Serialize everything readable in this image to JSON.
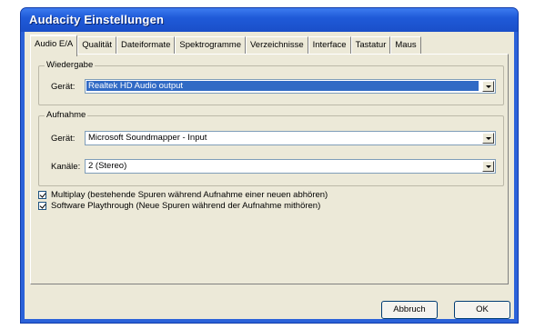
{
  "window": {
    "title": "Audacity Einstellungen"
  },
  "tabs": [
    {
      "label": "Audio E/A",
      "active": true
    },
    {
      "label": "Qualität"
    },
    {
      "label": "Dateiformate"
    },
    {
      "label": "Spektrogramme"
    },
    {
      "label": "Verzeichnisse"
    },
    {
      "label": "Interface"
    },
    {
      "label": "Tastatur"
    },
    {
      "label": "Maus"
    }
  ],
  "playback": {
    "group_label": "Wiedergabe",
    "device_label": "Gerät:",
    "device_value": "Realtek HD Audio output"
  },
  "recording": {
    "group_label": "Aufnahme",
    "device_label": "Gerät:",
    "device_value": "Microsoft Soundmapper - Input",
    "channels_label": "Kanäle:",
    "channels_value": "2 (Stereo)"
  },
  "options": [
    {
      "label": "Multiplay (bestehende Spuren während Aufnahme einer neuen abhören)",
      "checked": true
    },
    {
      "label": "Software Playthrough (Neue Spuren während der Aufnahme mithören)",
      "checked": true
    }
  ],
  "buttons": {
    "cancel": "Abbruch",
    "ok": "OK"
  }
}
